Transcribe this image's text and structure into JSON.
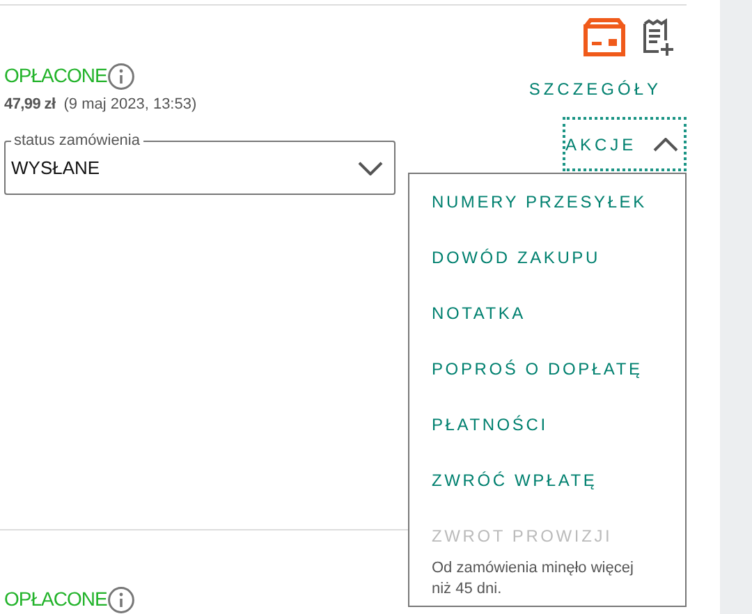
{
  "orders": [
    {
      "payment_status": "OPŁACONE",
      "amount": "47,99 zł",
      "date": "(9 maj 2023, 13:53)",
      "details_link": "SZCZEGÓŁY",
      "status_field": {
        "label": "status zamówienia",
        "value": "WYSŁANE"
      },
      "actions": {
        "label": "AKCJE",
        "expanded": true,
        "items": [
          {
            "label": "NUMERY PRZESYŁEK",
            "disabled": false
          },
          {
            "label": "DOWÓD ZAKUPU",
            "disabled": false
          },
          {
            "label": "NOTATKA",
            "disabled": false
          },
          {
            "label": "POPROŚ O DOPŁATĘ",
            "disabled": false
          },
          {
            "label": "PŁATNOŚCI",
            "disabled": false
          },
          {
            "label": "ZWRÓĆ WPŁATĘ",
            "disabled": false
          },
          {
            "label": "ZWROT PROWIZJI",
            "disabled": true,
            "note": "Od zamówienia minęło więcej niż 45 dni."
          }
        ]
      }
    },
    {
      "payment_status": "OPŁACONE"
    }
  ]
}
